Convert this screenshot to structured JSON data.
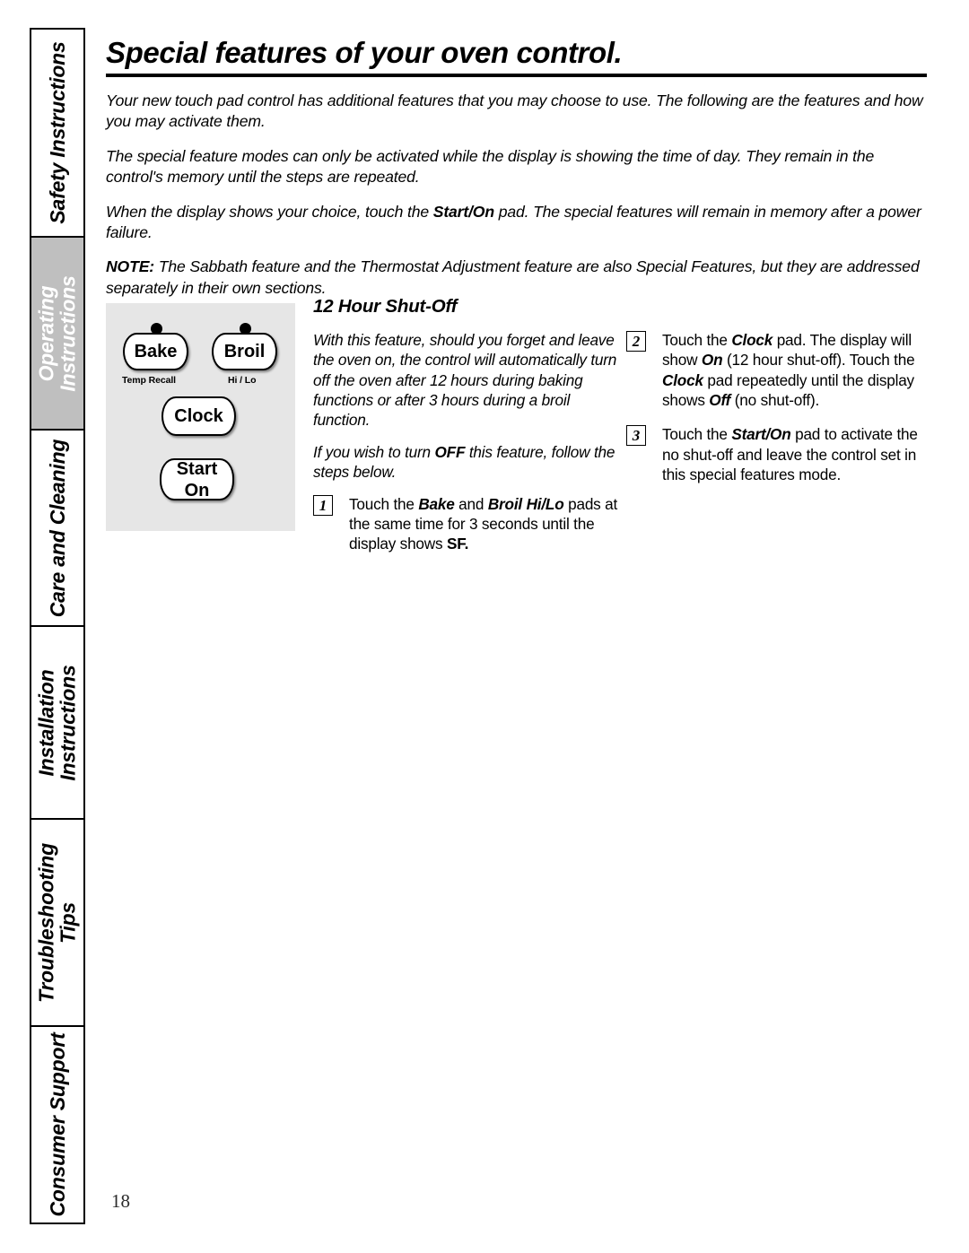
{
  "page": {
    "number": "18",
    "title": "Special features of your oven control."
  },
  "colors": {
    "active_tab_bg": "#bfbfbf",
    "panel_bg": "#e6e6e6",
    "rule": "#000000"
  },
  "sidebar": {
    "tabs": [
      {
        "label": "Safety Instructions",
        "active": false
      },
      {
        "label": "Operating\nInstructions",
        "active": true
      },
      {
        "label": "Care and Cleaning",
        "active": false
      },
      {
        "label": "Installation\nInstructions",
        "active": false
      },
      {
        "label": "Troubleshooting\nTips",
        "active": false
      },
      {
        "label": "Consumer Support",
        "active": false
      }
    ]
  },
  "intro": {
    "p1": "Your new touch pad control has additional features that you may choose to use. The following are the features and how you may activate them.",
    "p2": "The special feature modes can only be activated while the display is showing the time of day. They remain in the control's memory until the steps are repeated.",
    "p3_a": "When the display shows your choice, touch the ",
    "p3_b": "Start/On",
    "p3_c": " pad. The special features will remain in memory after a power failure.",
    "p4_label": "NOTE:",
    "p4_text": " The Sabbath feature and the Thermostat Adjustment feature are also Special Features, but they are addressed separately in their own sections."
  },
  "control_panel": {
    "bake_label": "Bake",
    "bake_sub": "Temp Recall",
    "broil_label": "Broil",
    "broil_sub": "Hi / Lo",
    "clock_label": "Clock",
    "start_label_top": "Start",
    "start_label_bottom": "On"
  },
  "feature": {
    "heading": "12 Hour Shut-Off",
    "body1": "With this feature, should you forget and leave the oven on, the control will automatically turn off the oven after 12 hours during baking functions or after 3 hours during a broil function.",
    "body2_a": "If you wish to turn ",
    "body2_b": "OFF",
    "body2_c": " this feature, follow the steps below.",
    "steps": [
      {
        "num": "1",
        "t1": "Touch the ",
        "b1": "Bake",
        "t2": " and ",
        "b2": "Broil Hi/Lo",
        "t3": " pads at the same time for 3 seconds until the display shows ",
        "b3": "SF.",
        "t4": ""
      },
      {
        "num": "2",
        "t1": "Touch the ",
        "b1": "Clock",
        "t2": " pad. The display will show ",
        "b2": "On",
        "t3": " (12 hour shut-off). Touch the ",
        "b3": "Clock",
        "t4": " pad repeatedly until the display shows ",
        "b4": "Off",
        "t5": " (no shut-off)."
      },
      {
        "num": "3",
        "t1": "Touch the ",
        "b1": "Start/On",
        "t2": " pad to activate the no shut-off and leave the control set in this special features mode."
      }
    ]
  }
}
